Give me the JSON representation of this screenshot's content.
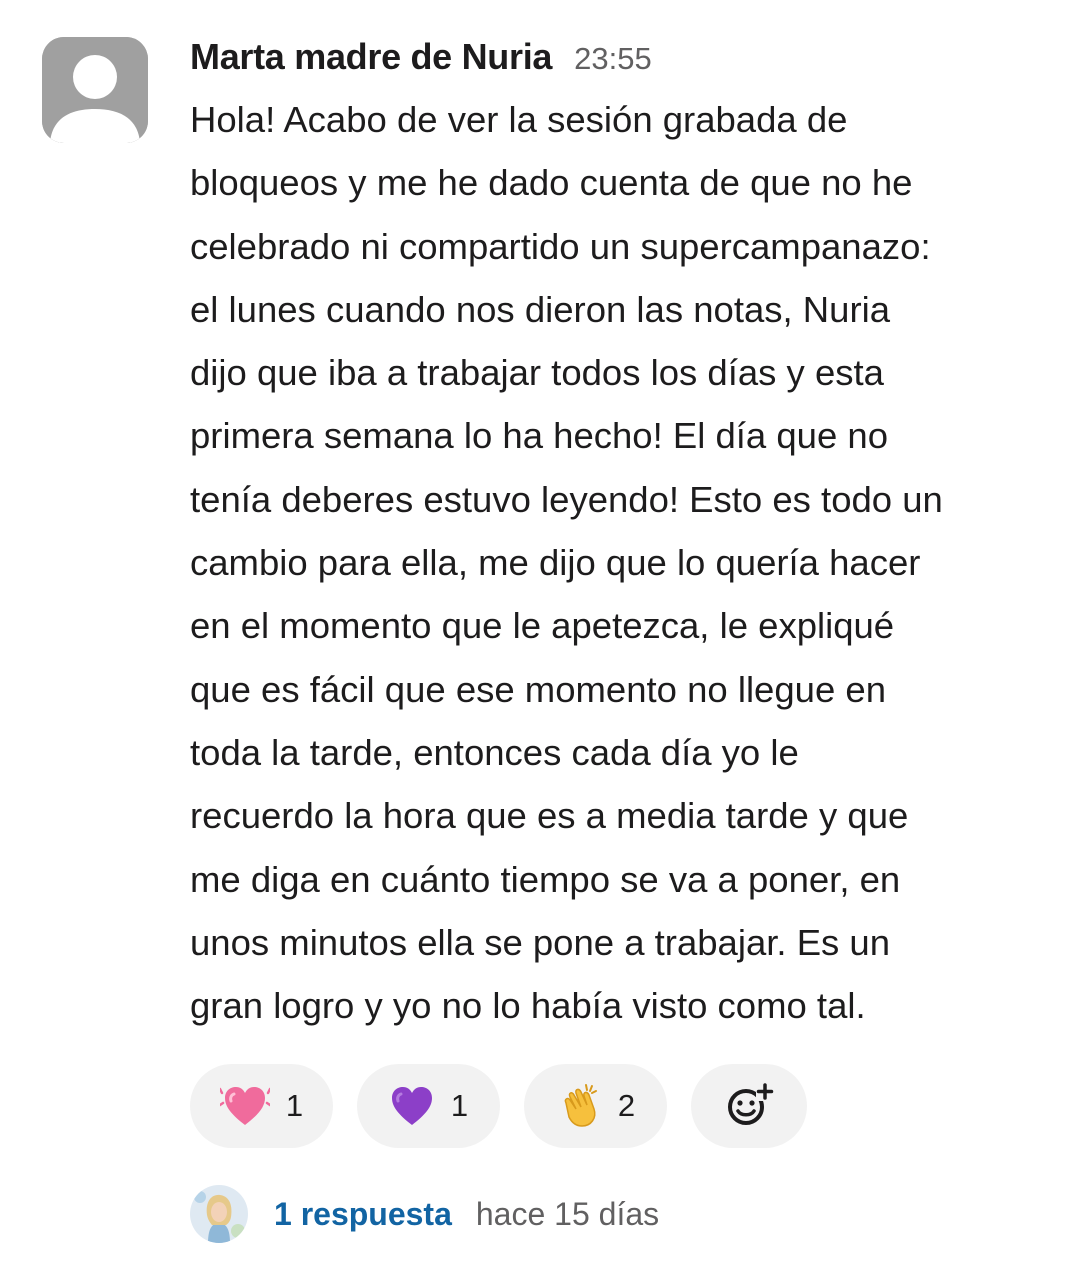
{
  "message": {
    "author": "Marta madre de Nuria",
    "timestamp": "23:55",
    "avatar_icon": "default-user-silhouette-icon",
    "lines": [
      "Hola! Acabo de ver la sesión grabada de",
      "bloqueos y me he dado cuenta de que no he",
      "celebrado ni compartido un supercampanazo:",
      "el lunes cuando nos dieron las notas, Nuria",
      "dijo que iba a trabajar todos los días y esta",
      "primera semana lo ha hecho! El día que no",
      "tenía deberes estuvo leyendo! Esto es todo un",
      "cambio para ella, me dijo que lo quería hacer",
      "en el momento que le apetezca, le expliqué",
      "que es fácil que ese momento no llegue en",
      "toda la tarde, entonces cada día yo le",
      "recuerdo la hora que es a media tarde y que",
      "me diga en cuánto tiempo se va a poner, en",
      "unos minutos ella se pone a trabajar. Es un",
      "gran logro y yo no lo había visto como tal."
    ]
  },
  "reactions": [
    {
      "emoji": "beating-heart-icon",
      "count": "1"
    },
    {
      "emoji": "purple-heart-icon",
      "count": "1"
    },
    {
      "emoji": "clapping-hands-icon",
      "count": "2"
    }
  ],
  "add_reaction_icon": "add-reaction-icon",
  "thread": {
    "replies": "1 respuesta",
    "ago": "hace 15 días"
  },
  "colors": {
    "text": "#1d1c1d",
    "muted": "#616061",
    "link": "#1264a3",
    "pill": "#f2f2f2",
    "avatar_bg": "#a0a0a0"
  }
}
